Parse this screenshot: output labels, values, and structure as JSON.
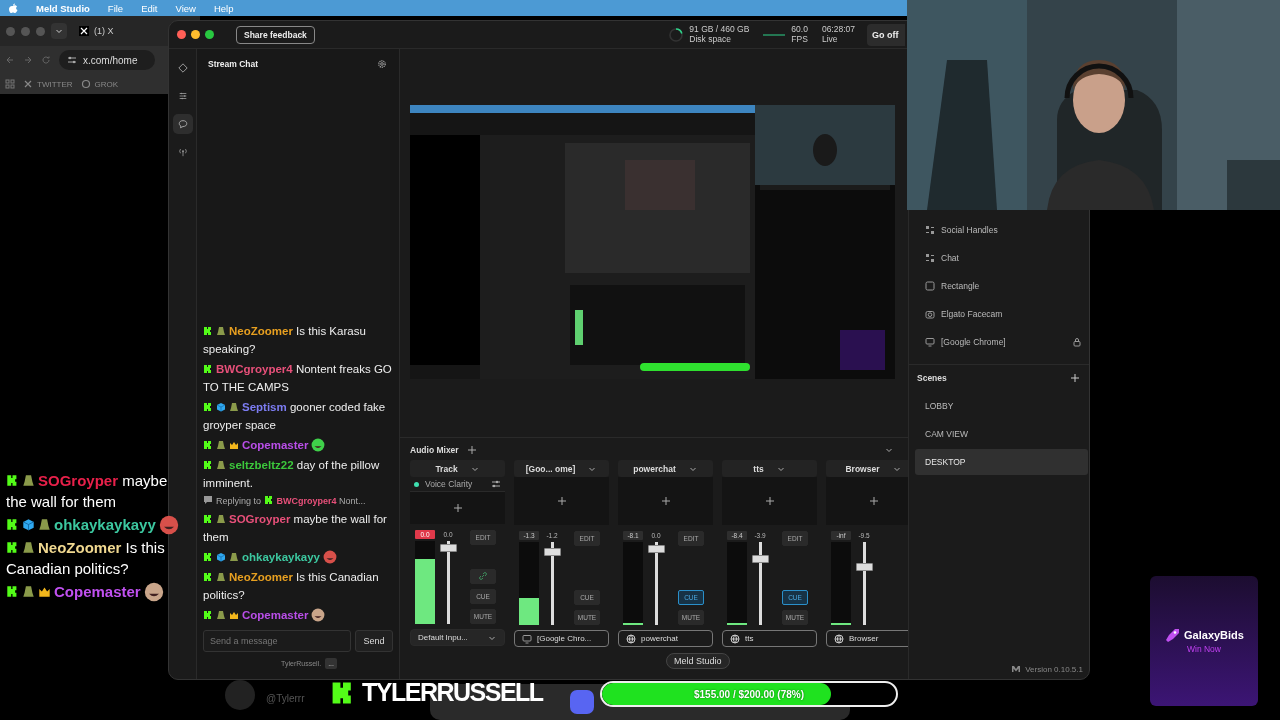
{
  "menu_bar": {
    "app": "Meld Studio",
    "items": [
      "File",
      "Edit",
      "View",
      "Help"
    ]
  },
  "browser": {
    "tab": "(1) X",
    "url": "x.com/home",
    "bookmarks": [
      {
        "kind": "x",
        "label": "TWITTER"
      },
      {
        "kind": "grok",
        "label": "GROK"
      }
    ]
  },
  "meld": {
    "feedback": "Share feedback",
    "stats": {
      "disk": {
        "value": "91 GB / 460 GB",
        "label": "Disk space"
      },
      "fps": {
        "value": "60.0",
        "label": "FPS"
      },
      "time": {
        "value": "06:28:07",
        "label": "Live"
      }
    },
    "go_button": "Go off",
    "rail": [
      {
        "kind": "diamond",
        "selected": false
      },
      {
        "kind": "sliders",
        "selected": false
      },
      {
        "kind": "chat",
        "selected": true
      },
      {
        "kind": "antenna",
        "selected": false
      }
    ],
    "chat": {
      "title": "Stream Chat",
      "messages": [
        {
          "badges": [
            {
              "kind": "kick"
            },
            {
              "kind": "figure"
            }
          ],
          "user": "NeoZoomer",
          "color": "#e8a020",
          "text": "Is this Karasu speaking?"
        },
        {
          "badges": [
            {
              "kind": "kick"
            }
          ],
          "user": "BWCgroyper4",
          "color": "#e8507a",
          "text": "Nontent freaks GO TO THE CAMPS"
        },
        {
          "badges": [
            {
              "kind": "kick"
            },
            {
              "kind": "cube"
            },
            {
              "kind": "figure"
            }
          ],
          "user": "Septism",
          "color": "#7c7cf2",
          "text": "gooner coded fake groyper space"
        },
        {
          "badges": [
            {
              "kind": "kick"
            },
            {
              "kind": "figure"
            },
            {
              "kind": "crown"
            }
          ],
          "user": "Copemaster",
          "color": "#b94ee8",
          "emote": {
            "kind": "blob"
          }
        },
        {
          "badges": [
            {
              "kind": "kick"
            },
            {
              "kind": "figure"
            }
          ],
          "user": "seltzbeltz22",
          "color": "#3cc83c",
          "text": "day of the pillow imminent."
        },
        {
          "kind": "reply",
          "label": "Replying to",
          "user": "BWCgroyper4",
          "color": "#e8507a",
          "text": "Nont..."
        },
        {
          "badges": [
            {
              "kind": "kick"
            },
            {
              "kind": "figure"
            }
          ],
          "user": "SOGroyper",
          "color": "#e8507a",
          "text": "maybe the wall for them"
        },
        {
          "badges": [
            {
              "kind": "kick"
            },
            {
              "kind": "cube"
            },
            {
              "kind": "figure"
            }
          ],
          "user": "ohkaykaykayy",
          "color": "#3cc8a0",
          "emote": {
            "kind": "ball"
          }
        },
        {
          "badges": [
            {
              "kind": "kick"
            },
            {
              "kind": "figure"
            }
          ],
          "user": "NeoZoomer",
          "color": "#e8a020",
          "text": "Is this Canadian politics?"
        },
        {
          "badges": [
            {
              "kind": "kick"
            },
            {
              "kind": "figure"
            },
            {
              "kind": "crown"
            }
          ],
          "user": "Copemaster",
          "color": "#b94ee8",
          "emote": {
            "kind": "face"
          }
        }
      ],
      "placeholder": "Send a message",
      "send": "Send",
      "account": "TylerRussell.",
      "more": "..."
    },
    "layers": [
      {
        "kind": "group",
        "label": "Social Handles",
        "locked": false
      },
      {
        "kind": "group",
        "label": "Chat",
        "locked": false
      },
      {
        "kind": "shape",
        "label": "Rectangle",
        "locked": false
      },
      {
        "kind": "camera",
        "label": "Elgato Facecam",
        "locked": false
      },
      {
        "kind": "screen",
        "label": "[Google Chrome]",
        "locked": true
      }
    ],
    "scenes": {
      "title": "Scenes",
      "items": [
        {
          "label": "LOBBY",
          "selected": false
        },
        {
          "label": "CAM VIEW",
          "selected": false
        },
        {
          "label": "DESKTOP",
          "selected": true
        }
      ]
    },
    "mixer": {
      "title": "Audio Mixer",
      "tracks": [
        {
          "name": "Track",
          "effect": {
            "label": "Voice Clarity",
            "on": true
          },
          "peak": "0.0",
          "clipping": true,
          "meter": {
            "level": 0.78
          },
          "gain": "0.0",
          "level": 0.92,
          "edit": "EDIT",
          "linked": true,
          "cue": {
            "label": "CUE",
            "on": false
          },
          "mute": "MUTE",
          "source": {
            "kind": "input",
            "label": "Default Inpu..."
          }
        },
        {
          "name": "[Goo... ome]",
          "peak": "-1.3",
          "clipping": false,
          "meter": {
            "level": 0.32
          },
          "gain": "-1.2",
          "level": 0.88,
          "edit": "EDIT",
          "linked": false,
          "cue": {
            "label": "CUE",
            "on": false
          },
          "mute": "MUTE",
          "source": {
            "kind": "screen",
            "label": "[Google Chro..."
          }
        },
        {
          "name": "powerchat",
          "peak": "-8.1",
          "clipping": false,
          "meter": {
            "level": 0.02
          },
          "gain": "0.0",
          "level": 0.92,
          "edit": "EDIT",
          "linked": false,
          "cue": {
            "label": "CUE",
            "on": true
          },
          "mute": "MUTE",
          "source": {
            "kind": "web",
            "label": "powerchat"
          }
        },
        {
          "name": "tts",
          "peak": "-8.4",
          "clipping": false,
          "meter": {
            "level": 0.02
          },
          "gain": "-3.9",
          "level": 0.8,
          "edit": "EDIT",
          "linked": false,
          "cue": {
            "label": "CUE",
            "on": true
          },
          "mute": "MUTE",
          "source": {
            "kind": "web",
            "label": "tts"
          }
        },
        {
          "name": "Browser",
          "peak": "-inf",
          "clipping": false,
          "meter": {
            "level": 0.02
          },
          "gain": "-9.5",
          "level": 0.7,
          "source": {
            "kind": "web",
            "label": "Browser"
          }
        }
      ]
    },
    "version": "Version 0.10.5.1"
  },
  "tooltip": "Meld Studio",
  "overlay_chat": [
    {
      "badges": [
        {
          "kind": "kick"
        },
        {
          "kind": "figure"
        }
      ],
      "user": "SOGroyper",
      "color": "#e8204a",
      "text": "maybe the wall for them"
    },
    {
      "badges": [
        {
          "kind": "kick"
        },
        {
          "kind": "cube"
        },
        {
          "kind": "figure"
        }
      ],
      "user": "ohkaykaykayy",
      "color": "#3cc8a0",
      "emote": {
        "kind": "ball"
      }
    },
    {
      "badges": [
        {
          "kind": "kick"
        },
        {
          "kind": "figure"
        }
      ],
      "user": "NeoZoomer",
      "color": "#f0d890",
      "text": "Is this Canadian politics?"
    },
    {
      "badges": [
        {
          "kind": "kick"
        },
        {
          "kind": "figure"
        },
        {
          "kind": "crown"
        }
      ],
      "user": "Copemaster",
      "color": "#c050f0",
      "emote": {
        "kind": "face"
      }
    }
  ],
  "streamer": {
    "handle": "@Tylerrr",
    "name": "TYLERRUSSELL"
  },
  "dock": [
    {
      "color": "#5865f2"
    }
  ],
  "goal": {
    "text": "$155.00 / $200.00 (78%)",
    "level": 0.78
  },
  "sponsor": {
    "name": "GalaxyBids",
    "tagline": "Win Now"
  }
}
